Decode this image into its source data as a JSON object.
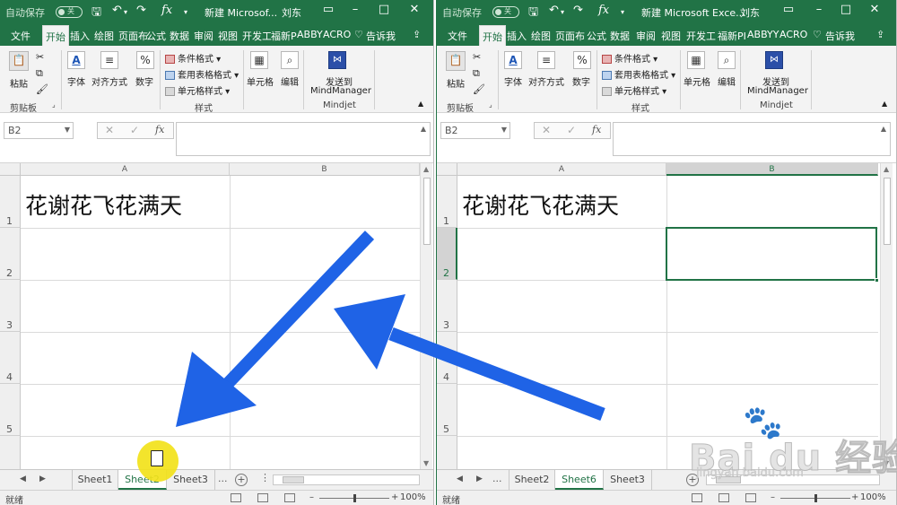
{
  "left": {
    "title_bar": {
      "autosave_label": "自动保存",
      "toggle_state": "关",
      "title": "新建 Microsof...",
      "user": "刘东"
    },
    "tabs": [
      "文件",
      "开始",
      "插入",
      "绘图",
      "页面布",
      "公式",
      "数据",
      "审阅",
      "视图",
      "开发工",
      "福新P",
      "ABBY",
      "ACRO",
      "告诉我"
    ],
    "active_tab": "开始",
    "ribbon": {
      "paste": "粘贴",
      "clipboard_group": "剪贴板",
      "font": "字体",
      "alignment": "对齐方式",
      "number": "数字",
      "cond_format": "条件格式",
      "table_format": "套用表格格式",
      "cell_style": "单元格样式",
      "styles_group": "样式",
      "cells": "单元格",
      "editing": "编辑",
      "send_line1": "发送到",
      "send_line2": "MindManager",
      "mindjet_group": "Mindjet"
    },
    "name_box": "B2",
    "columns": [
      "A",
      "B"
    ],
    "rows": [
      "1",
      "2",
      "3",
      "4",
      "5"
    ],
    "cell_a1": "花谢花飞花满天",
    "sheets": [
      "Sheet1",
      "Sheet2",
      "Sheet3"
    ],
    "active_sheet": "Sheet2",
    "more": "...",
    "status": "就绪",
    "zoom": "100%"
  },
  "right": {
    "title_bar": {
      "autosave_label": "自动保存",
      "toggle_state": "关",
      "title": "新建 Microsoft Exce...",
      "user": "刘东"
    },
    "tabs": [
      "文件",
      "开始",
      "插入",
      "绘图",
      "页面布",
      "公式",
      "数据",
      "审阅",
      "视图",
      "开发工",
      "福新PI",
      "ABBYY",
      "ACRO",
      "告诉我"
    ],
    "active_tab": "开始",
    "ribbon": {
      "paste": "粘贴",
      "clipboard_group": "剪贴板",
      "font": "字体",
      "alignment": "对齐方式",
      "number": "数字",
      "cond_format": "条件格式",
      "table_format": "套用表格格式",
      "cell_style": "单元格样式",
      "styles_group": "样式",
      "cells": "单元格",
      "editing": "编辑",
      "send_line1": "发送到",
      "send_line2": "MindManager",
      "mindjet_group": "Mindjet"
    },
    "name_box": "B2",
    "columns": [
      "A",
      "B"
    ],
    "rows": [
      "1",
      "2",
      "3",
      "4",
      "5"
    ],
    "cell_a1": "花谢花飞花满天",
    "sheets": [
      "Sheet2",
      "Sheet6",
      "Sheet3"
    ],
    "active_sheet": "Sheet6",
    "more": "...",
    "status": "就绪",
    "zoom": "100%"
  },
  "watermark": {
    "brand": "Bai du 经验",
    "url": "jingyan.baidu.com"
  },
  "colors": {
    "excel_green": "#217346",
    "arrow_blue": "#1f63e6",
    "cursor_yellow": "#f2e21a"
  }
}
